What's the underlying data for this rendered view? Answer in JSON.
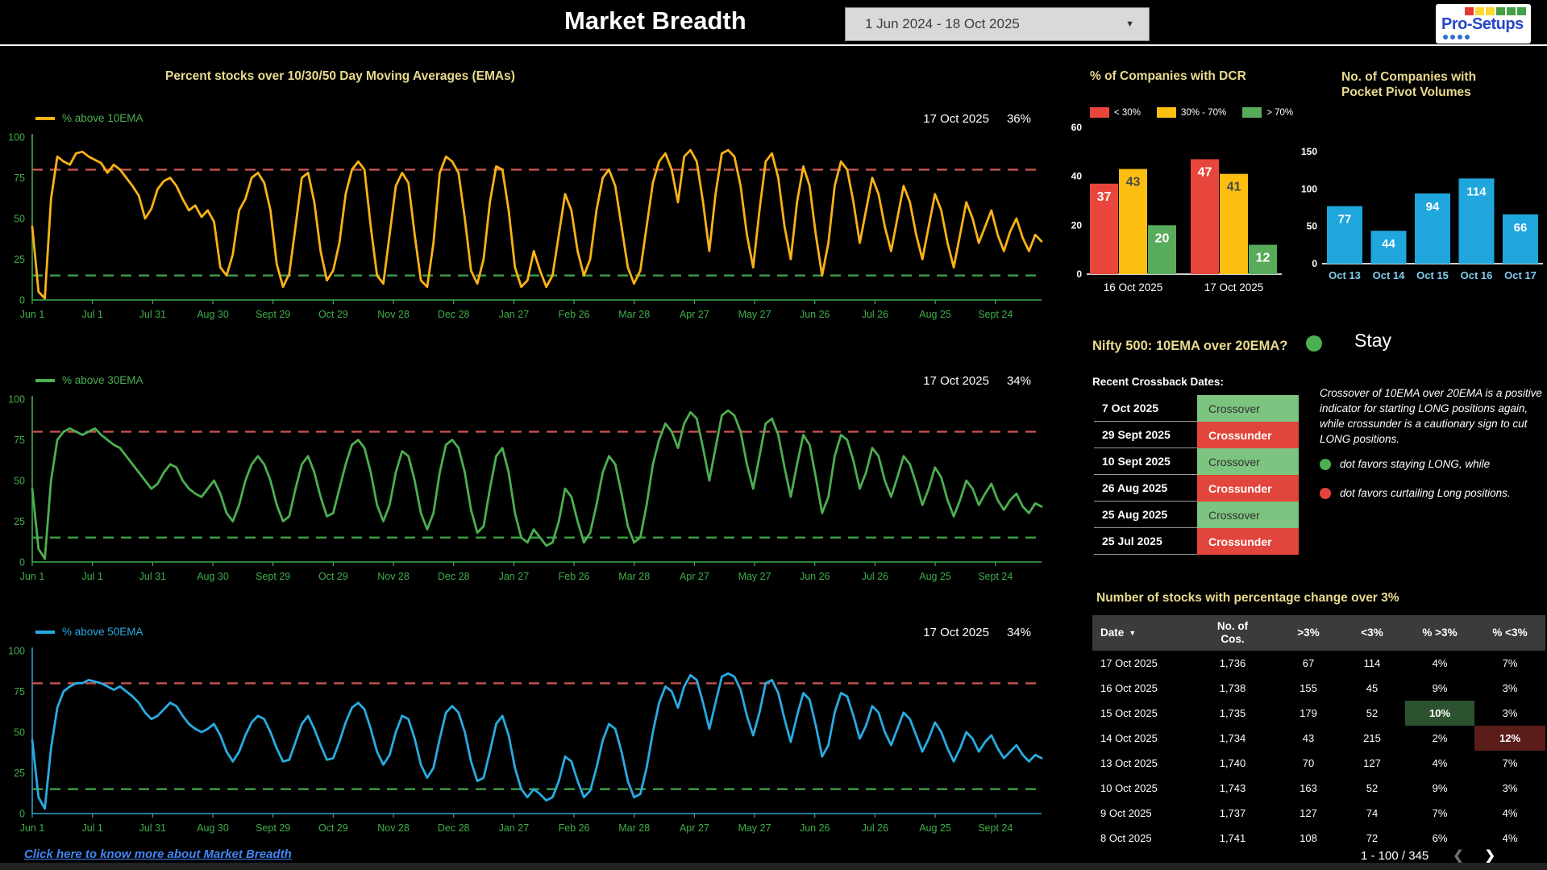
{
  "theme": {
    "accent_yellow": "#e9da8e",
    "tick_green": "#3fae49",
    "link_blue": "#4285f4"
  },
  "header": {
    "title": "Market Breadth",
    "date_range": "1 Jun 2024 - 18 Oct 2025",
    "logo": {
      "text": "Pro-Setups",
      "squares": [
        "#e53935",
        "#fdd835",
        "#fdd835",
        "#43a047",
        "#43a047",
        "#43a047"
      ],
      "dot_color": "#2f6fd0"
    }
  },
  "nifty_signal": {
    "title": "Nifty 500: 10EMA over 20EMA?",
    "status": "Stay",
    "dot_color": "#4caf50"
  },
  "crossback": {
    "heading": "Recent Crossback Dates:",
    "rows": [
      {
        "date": "7 Oct 2025",
        "status": "Crossover"
      },
      {
        "date": "29 Sept 2025",
        "status": "Crossunder"
      },
      {
        "date": "10 Sept 2025",
        "status": "Crossover"
      },
      {
        "date": "26 Aug 2025",
        "status": "Crossunder"
      },
      {
        "date": "25 Aug 2025",
        "status": "Crossover"
      },
      {
        "date": "25 Jul 2025",
        "status": "Crossunder"
      }
    ]
  },
  "explainer": {
    "paragraph": "Crossover of 10EMA over 20EMA is a positive indicator for starting LONG positions again, while crossunder is a cautionary sign to cut LONG positions.",
    "bullets": [
      {
        "color": "#4caf50",
        "text": "dot favors staying LONG, while"
      },
      {
        "color": "#e2453b",
        "text": "dot favors curtailing Long positions."
      }
    ]
  },
  "stocks_table": {
    "title": "Number of stocks with percentage change over 3%",
    "columns": [
      {
        "label": "Date",
        "sort": true
      },
      {
        "label": "No. of\nCos."
      },
      {
        "label": ">3%"
      },
      {
        "label": "<3%"
      },
      {
        "label": "% >3%"
      },
      {
        "label": "% <3%"
      }
    ],
    "rows": [
      [
        "17 Oct 2025",
        "1,736",
        "67",
        "114",
        "4%",
        "7%"
      ],
      [
        "16 Oct 2025",
        "1,738",
        "155",
        "45",
        "9%",
        "3%"
      ],
      [
        "15 Oct 2025",
        "1,735",
        "179",
        "52",
        "10%",
        "3%"
      ],
      [
        "14 Oct 2025",
        "1,734",
        "43",
        "215",
        "2%",
        "12%"
      ],
      [
        "13 Oct 2025",
        "1,740",
        "70",
        "127",
        "4%",
        "7%"
      ],
      [
        "10 Oct 2025",
        "1,743",
        "163",
        "52",
        "9%",
        "3%"
      ],
      [
        "9 Oct 2025",
        "1,737",
        "127",
        "74",
        "7%",
        "4%"
      ],
      [
        "8 Oct 2025",
        "1,741",
        "108",
        "72",
        "6%",
        "4%"
      ]
    ],
    "highlights": [
      {
        "row": 2,
        "col": 4,
        "bg": "#2d5230"
      },
      {
        "row": 3,
        "col": 5,
        "bg": "#5a1d1a"
      }
    ],
    "pagination": {
      "label": "1 - 100 / 345"
    }
  },
  "footer": {
    "link_text": "Click here to know more about Market Breadth"
  },
  "chart_data": [
    {
      "type": "line",
      "title": "Percent stocks over 10/30/50 Day Moving Averages (EMAs)",
      "ylim": [
        0,
        100
      ],
      "y_ticks": [
        100,
        75,
        50,
        25,
        0
      ],
      "tick_color": "#3fae49",
      "upper_threshold": 80,
      "upper_color": "#c75450",
      "lower_threshold": 15,
      "lower_color": "#3e9e4a",
      "x_tick_labels": [
        "Jun 1",
        "Jul 1",
        "Jul 31",
        "Aug 30",
        "Sept 29",
        "Oct 29",
        "Nov 28",
        "Dec 28",
        "Jan 27",
        "Feb 26",
        "Mar 28",
        "Apr 27",
        "May 27",
        "Jun 26",
        "Jul 26",
        "Aug 25",
        "Sept 24"
      ],
      "series": [
        {
          "name": "% above 10EMA",
          "color": "#fbb216",
          "legend_text_color": "#4caf50",
          "axis_color": "#3fae49",
          "date_label": "17 Oct 2025",
          "value_label": "36%",
          "values": [
            45,
            5,
            1,
            62,
            88,
            85,
            83,
            90,
            91,
            88,
            86,
            84,
            78,
            83,
            80,
            75,
            70,
            64,
            50,
            56,
            68,
            73,
            75,
            70,
            62,
            55,
            58,
            51,
            55,
            48,
            20,
            15,
            28,
            55,
            62,
            75,
            78,
            72,
            55,
            22,
            8,
            16,
            45,
            75,
            78,
            60,
            30,
            12,
            18,
            35,
            65,
            80,
            85,
            80,
            45,
            15,
            10,
            40,
            70,
            78,
            72,
            40,
            12,
            8,
            35,
            78,
            88,
            85,
            78,
            50,
            18,
            10,
            25,
            60,
            82,
            80,
            55,
            20,
            8,
            12,
            30,
            18,
            8,
            15,
            40,
            65,
            55,
            30,
            15,
            25,
            55,
            75,
            80,
            70,
            45,
            20,
            10,
            18,
            45,
            72,
            85,
            90,
            80,
            60,
            88,
            92,
            85,
            60,
            30,
            65,
            90,
            92,
            88,
            70,
            40,
            20,
            55,
            85,
            90,
            75,
            45,
            25,
            60,
            82,
            70,
            40,
            15,
            35,
            70,
            85,
            80,
            60,
            35,
            55,
            75,
            65,
            45,
            30,
            50,
            70,
            60,
            40,
            25,
            45,
            65,
            55,
            35,
            20,
            40,
            60,
            50,
            35,
            45,
            55,
            40,
            30,
            42,
            50,
            38,
            30,
            40,
            36
          ]
        },
        {
          "name": "% above 30EMA",
          "color": "#4caf50",
          "legend_text_color": "#4caf50",
          "axis_color": "#3fae49",
          "date_label": "17 Oct 2025",
          "value_label": "34%",
          "values": [
            45,
            8,
            2,
            50,
            75,
            80,
            82,
            80,
            78,
            80,
            82,
            78,
            75,
            72,
            70,
            65,
            60,
            55,
            50,
            45,
            48,
            55,
            60,
            58,
            50,
            45,
            42,
            40,
            45,
            50,
            42,
            30,
            25,
            35,
            50,
            60,
            65,
            60,
            50,
            35,
            25,
            28,
            45,
            60,
            65,
            55,
            40,
            28,
            30,
            45,
            60,
            72,
            75,
            70,
            55,
            35,
            25,
            35,
            55,
            68,
            65,
            50,
            30,
            20,
            30,
            55,
            72,
            75,
            70,
            55,
            32,
            18,
            22,
            45,
            65,
            70,
            55,
            30,
            15,
            12,
            20,
            15,
            10,
            12,
            25,
            45,
            40,
            25,
            12,
            18,
            35,
            55,
            65,
            60,
            42,
            22,
            12,
            15,
            35,
            60,
            75,
            85,
            80,
            70,
            85,
            92,
            88,
            70,
            50,
            70,
            90,
            93,
            90,
            80,
            60,
            45,
            65,
            85,
            88,
            78,
            58,
            40,
            60,
            78,
            72,
            52,
            30,
            40,
            65,
            78,
            75,
            62,
            45,
            55,
            70,
            65,
            50,
            40,
            52,
            65,
            60,
            48,
            35,
            45,
            58,
            52,
            38,
            28,
            38,
            50,
            45,
            35,
            42,
            48,
            38,
            32,
            38,
            42,
            34,
            30,
            36,
            34
          ]
        },
        {
          "name": "% above 50EMA",
          "color": "#29abe2",
          "legend_text_color": "#29abe2",
          "axis_color": "#2b9fd0",
          "date_label": "17 Oct 2025",
          "value_label": "34%",
          "values": [
            45,
            10,
            3,
            40,
            65,
            75,
            78,
            80,
            80,
            82,
            81,
            80,
            78,
            76,
            78,
            75,
            72,
            68,
            62,
            58,
            60,
            64,
            68,
            66,
            60,
            55,
            52,
            50,
            52,
            55,
            48,
            38,
            32,
            38,
            48,
            56,
            60,
            58,
            50,
            40,
            32,
            33,
            44,
            55,
            60,
            52,
            42,
            33,
            34,
            44,
            56,
            65,
            68,
            64,
            52,
            38,
            30,
            36,
            50,
            60,
            58,
            46,
            30,
            22,
            28,
            46,
            62,
            66,
            62,
            50,
            32,
            20,
            22,
            38,
            55,
            60,
            48,
            28,
            15,
            10,
            15,
            12,
            8,
            10,
            20,
            35,
            32,
            20,
            10,
            14,
            28,
            45,
            55,
            52,
            38,
            20,
            10,
            12,
            28,
            50,
            68,
            78,
            75,
            65,
            78,
            85,
            82,
            68,
            52,
            68,
            84,
            86,
            84,
            76,
            60,
            48,
            62,
            80,
            82,
            74,
            58,
            44,
            60,
            74,
            70,
            54,
            35,
            42,
            62,
            74,
            72,
            60,
            46,
            54,
            66,
            62,
            50,
            42,
            52,
            62,
            58,
            48,
            38,
            46,
            56,
            50,
            40,
            32,
            40,
            50,
            46,
            38,
            44,
            48,
            40,
            34,
            38,
            42,
            36,
            32,
            36,
            34
          ]
        }
      ]
    },
    {
      "type": "bar",
      "title": "% of Companies with DCR",
      "categories": [
        "16 Oct 2025",
        "17 Oct 2025"
      ],
      "series": [
        {
          "name": "< 30%",
          "color": "#e8463c",
          "label_color": "#ffffff",
          "values": [
            37,
            47
          ]
        },
        {
          "name": "30% - 70%",
          "color": "#fcbf10",
          "label_color": "#4a4a4a",
          "values": [
            43,
            41
          ]
        },
        {
          "name": "> 70%",
          "color": "#57ab5a",
          "label_color": "#ffffff",
          "values": [
            20,
            12
          ]
        }
      ],
      "ylim": [
        0,
        60
      ],
      "yticks": [
        0,
        20,
        40,
        60
      ]
    },
    {
      "type": "bar",
      "title": "No. of Companies with Pocket Pivot Volumes",
      "categories": [
        "Oct 13",
        "Oct 14",
        "Oct 15",
        "Oct 16",
        "Oct 17"
      ],
      "values": [
        77,
        44,
        94,
        114,
        66
      ],
      "color": "#1fa6dd",
      "x_label_color": "#7fcdee",
      "ylim": [
        0,
        150
      ],
      "yticks": [
        0,
        50,
        100,
        150
      ]
    }
  ]
}
